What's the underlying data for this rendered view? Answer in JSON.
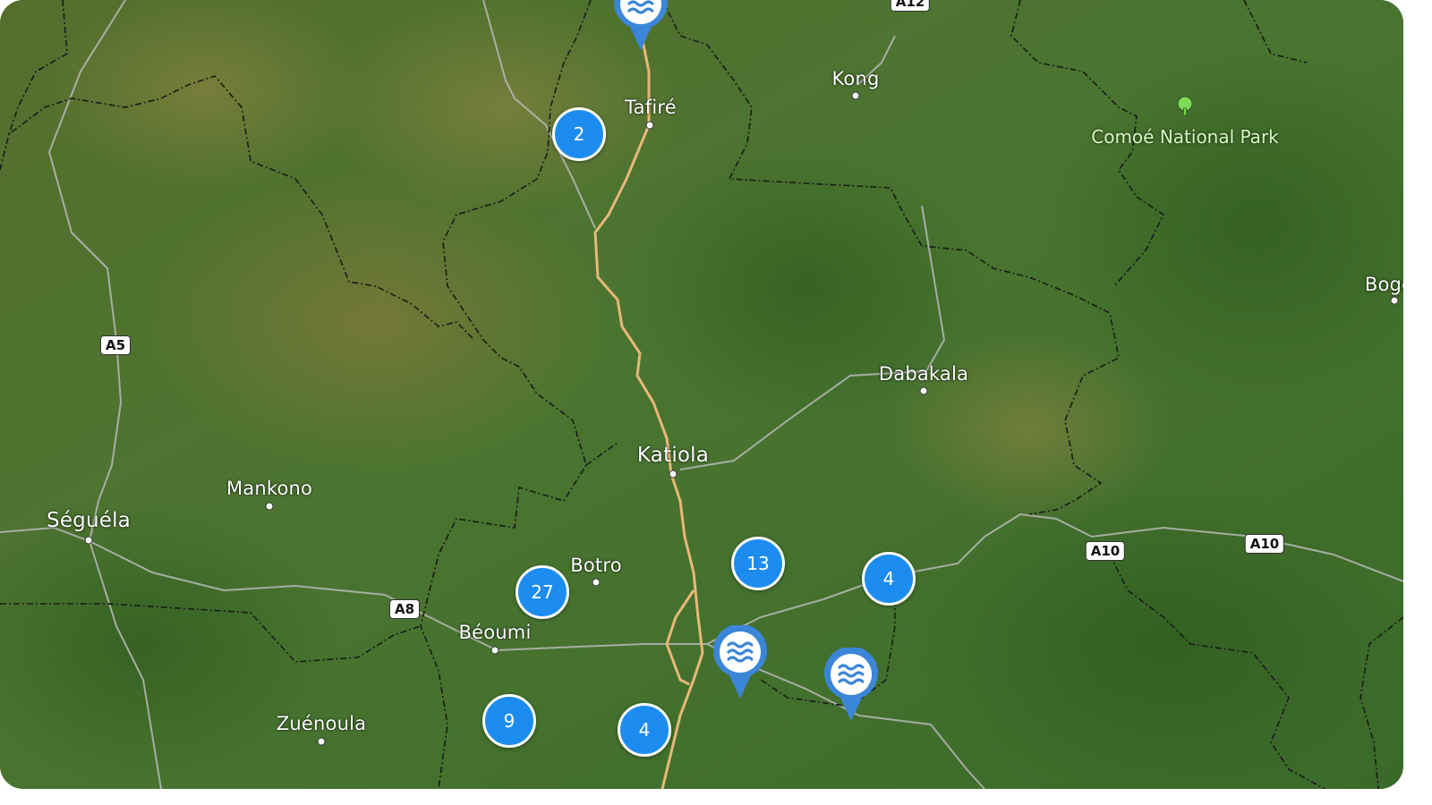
{
  "places": [
    {
      "id": "tafire",
      "name": "Tafiré"
    },
    {
      "id": "kong",
      "name": "Kong"
    },
    {
      "id": "dabakala",
      "name": "Dabakala"
    },
    {
      "id": "katiola",
      "name": "Katiola"
    },
    {
      "id": "mankono",
      "name": "Mankono"
    },
    {
      "id": "seguela",
      "name": "Séguéla"
    },
    {
      "id": "botro",
      "name": "Botro"
    },
    {
      "id": "beoumi",
      "name": "Béoumi"
    },
    {
      "id": "zuenoula",
      "name": "Zuénoula"
    },
    {
      "id": "bogo",
      "name": "Bogo"
    }
  ],
  "park": {
    "name": "Comoé National Park",
    "icon": "tree-icon"
  },
  "road_shields": [
    "A12",
    "A5",
    "A8",
    "A10",
    "A10"
  ],
  "clusters": [
    {
      "id": "c1",
      "count": "2"
    },
    {
      "id": "c2",
      "count": "13"
    },
    {
      "id": "c3",
      "count": "4"
    },
    {
      "id": "c4",
      "count": "27"
    },
    {
      "id": "c5",
      "count": "9"
    },
    {
      "id": "c6",
      "count": "4"
    }
  ],
  "water_pins": [
    {
      "id": "p1",
      "icon": "water-waves-icon"
    },
    {
      "id": "p2",
      "icon": "water-waves-icon"
    },
    {
      "id": "p3",
      "icon": "water-waves-icon"
    }
  ],
  "colors": {
    "cluster": "#1d8cf0",
    "pin": "#3b86d8",
    "main_road": "#e8b877",
    "border": "#1a1a1a",
    "secondary_road": "#b9b9b9"
  }
}
